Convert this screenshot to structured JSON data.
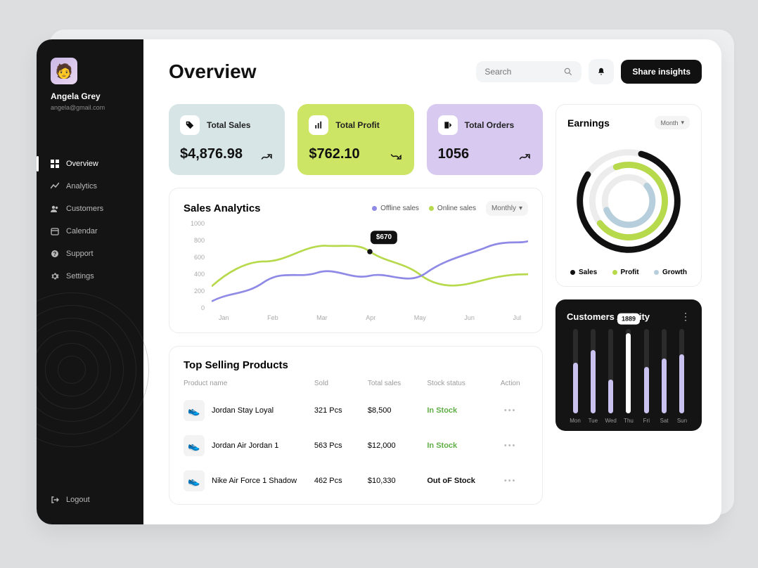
{
  "user": {
    "name": "Angela Grey",
    "email": "angela@gmail.com"
  },
  "sidebar": {
    "items": [
      {
        "label": "Overview",
        "active": true
      },
      {
        "label": "Analytics",
        "active": false
      },
      {
        "label": "Customers",
        "active": false
      },
      {
        "label": "Calendar",
        "active": false
      },
      {
        "label": "Support",
        "active": false
      },
      {
        "label": "Settings",
        "active": false
      }
    ],
    "logout_label": "Logout"
  },
  "header": {
    "title": "Overview",
    "search_placeholder": "Search",
    "share_label": "Share insights"
  },
  "stats": [
    {
      "label": "Total Sales",
      "value": "$4,876.98",
      "trend": "up",
      "color": "#d7e5e7"
    },
    {
      "label": "Total Profit",
      "value": "$762.10",
      "trend": "down",
      "color": "#cde564"
    },
    {
      "label": "Total Orders",
      "value": "1056",
      "trend": "up",
      "color": "#d7c9f0"
    }
  ],
  "analytics": {
    "title": "Sales Analytics",
    "legend": [
      {
        "label": "Offline sales",
        "color": "#8f8ae6"
      },
      {
        "label": "Online sales",
        "color": "#b7d94c"
      }
    ],
    "period_label": "Monthly",
    "tooltip_value": "$670",
    "y_ticks": [
      "1000",
      "800",
      "600",
      "400",
      "200",
      "0"
    ],
    "x_ticks": [
      "Jan",
      "Feb",
      "Mar",
      "Apr",
      "May",
      "Jun",
      "Jul"
    ]
  },
  "products": {
    "title": "Top Selling Products",
    "columns": [
      "Product name",
      "Sold",
      "Total sales",
      "Stock status",
      "Action"
    ],
    "rows": [
      {
        "name": "Jordan Stay Loyal",
        "sold": "321 Pcs",
        "total": "$8,500",
        "stock": "In Stock",
        "stock_class": "instock"
      },
      {
        "name": "Jordan Air Jordan 1",
        "sold": "563 Pcs",
        "total": "$12,000",
        "stock": "In Stock",
        "stock_class": "instock"
      },
      {
        "name": "Nike Air Force 1 Shadow",
        "sold": "462 Pcs",
        "total": "$10,330",
        "stock": "Out oF Stock",
        "stock_class": "outstock"
      }
    ]
  },
  "earnings": {
    "title": "Earnings",
    "period_label": "Month",
    "legend": [
      {
        "label": "Sales",
        "color": "#111111"
      },
      {
        "label": "Profit",
        "color": "#b7d94c"
      },
      {
        "label": "Growth",
        "color": "#b7cfdc"
      }
    ]
  },
  "activity": {
    "title": "Customers Activity",
    "tooltip_value": "1889",
    "days": [
      "Mon",
      "Tue",
      "Wed",
      "Thu",
      "Fri",
      "Sat",
      "Sun"
    ]
  },
  "chart_data": [
    {
      "type": "line",
      "title": "Sales Analytics",
      "xlabel": "",
      "ylabel": "",
      "ylim": [
        0,
        1000
      ],
      "categories": [
        "Jan",
        "Feb",
        "Mar",
        "Apr",
        "May",
        "Jun",
        "Jul"
      ],
      "series": [
        {
          "name": "Offline sales",
          "color": "#8f8ae6",
          "values": [
            220,
            360,
            430,
            480,
            440,
            640,
            780
          ]
        },
        {
          "name": "Online sales",
          "color": "#b7d94c",
          "values": [
            320,
            560,
            740,
            670,
            580,
            380,
            430
          ]
        }
      ],
      "annotation": {
        "x": "Apr",
        "series": "Online sales",
        "label": "$670"
      }
    },
    {
      "type": "pie",
      "title": "Earnings",
      "series": [
        {
          "name": "Sales",
          "color": "#111111",
          "value": 80
        },
        {
          "name": "Profit",
          "color": "#b7d94c",
          "value": 70
        },
        {
          "name": "Growth",
          "color": "#b7cfdc",
          "value": 55
        }
      ],
      "note": "rendered as concentric arcs; value = percent of full circle"
    },
    {
      "type": "bar",
      "title": "Customers Activity",
      "categories": [
        "Mon",
        "Tue",
        "Wed",
        "Thu",
        "Fri",
        "Sat",
        "Sun"
      ],
      "values": [
        1200,
        1500,
        800,
        1889,
        1100,
        1300,
        1400
      ],
      "ylim": [
        0,
        2000
      ],
      "colors": [
        "#c9c2ee",
        "#c9c2ee",
        "#c9c2ee",
        "#ffffff",
        "#c9c2ee",
        "#c9c2ee",
        "#c9c2ee"
      ],
      "annotation": {
        "x": "Thu",
        "label": "1889"
      }
    }
  ]
}
